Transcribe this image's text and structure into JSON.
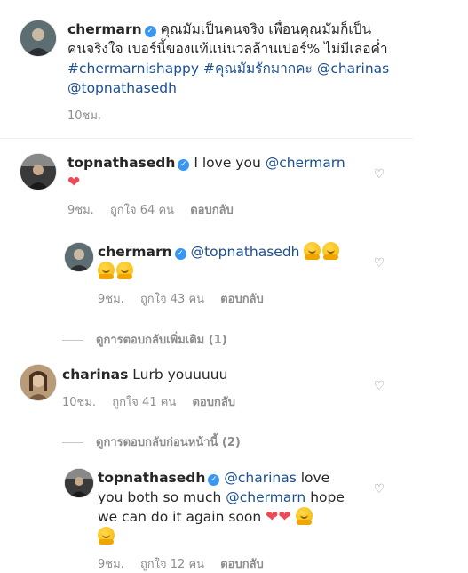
{
  "caption": {
    "username": "chermarn",
    "text": "คุณมัมเป็นคนจริง เพื่อนคุณมัมก็เป็นคนจริงใจ เบอร์นี้ของแท้แน่นวลล้านเปอร์% ไม่มีเล่อค่ำ ",
    "hashtags": [
      "#chermarnishappy",
      "#คุณมัมรักมากคะ"
    ],
    "mentions": [
      "@charinas",
      "@topnathasedh"
    ],
    "time": "10ชม."
  },
  "comments": [
    {
      "username": "topnathasedh",
      "verified": true,
      "text": "I love you",
      "mention": "@chermarn",
      "emoji": "heart",
      "time": "9ชม.",
      "likes": "ถูกใจ 64 คน",
      "reply": "ตอบกลับ",
      "view_replies": "ดูการตอบกลับเพิ่มเติม (1)",
      "replies": [
        {
          "username": "chermarn",
          "verified": true,
          "mention": "@topnathasedh",
          "emoji": "hugging-face",
          "time": "9ชม.",
          "likes": "ถูกใจ 43 คน",
          "reply": "ตอบกลับ"
        }
      ]
    },
    {
      "username": "charinas",
      "verified": false,
      "text": "Lurb youuuuu",
      "time": "10ชม.",
      "likes": "ถูกใจ 41 คน",
      "reply": "ตอบกลับ",
      "view_replies": "ดูการตอบกลับก่อนหน้านี้ (2)",
      "replies": [
        {
          "username": "topnathasedh",
          "verified": true,
          "mention1": "@charinas",
          "text1": "love you both so much",
          "mention2": "@chermarn",
          "text2": "hope we can do it again soon",
          "emoji": "hearts-hug",
          "time": "9ชม.",
          "likes": "ถูกใจ 12 คน",
          "reply": "ตอบกลับ"
        }
      ]
    }
  ],
  "colors": {
    "mention": "#1a4f91",
    "meta": "#8e8e8e",
    "verified": "#3897f0",
    "heart": "#ed4956"
  }
}
